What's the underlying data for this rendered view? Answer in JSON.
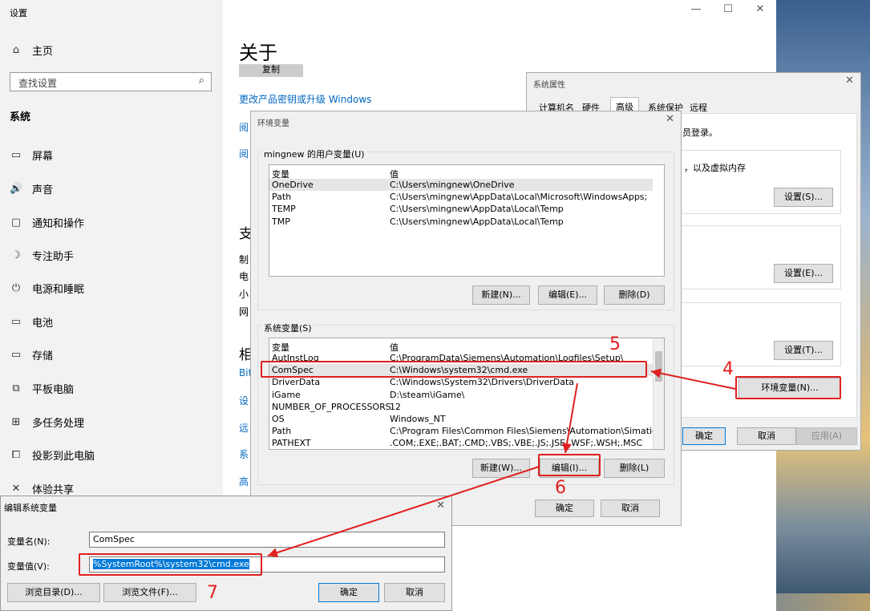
{
  "settings": {
    "window_title": "设置",
    "minimize": "—",
    "maximize": "☐",
    "close": "✕",
    "home": "主页",
    "search_placeholder": "查找设置",
    "section": "系统",
    "nav": [
      {
        "label": "屏幕",
        "icon": "monitor-icon",
        "glyph": "▭"
      },
      {
        "label": "声音",
        "icon": "speaker-icon",
        "glyph": "🔊"
      },
      {
        "label": "通知和操作",
        "icon": "notification-icon",
        "glyph": "▢"
      },
      {
        "label": "专注助手",
        "icon": "moon-icon",
        "glyph": "☽"
      },
      {
        "label": "电源和睡眠",
        "icon": "power-icon",
        "glyph": "⏻"
      },
      {
        "label": "电池",
        "icon": "battery-icon",
        "glyph": "▭"
      },
      {
        "label": "存储",
        "icon": "storage-icon",
        "glyph": "▭"
      },
      {
        "label": "平板电脑",
        "icon": "tablet-icon",
        "glyph": "⧉"
      },
      {
        "label": "多任务处理",
        "icon": "multitask-icon",
        "glyph": "⊞"
      },
      {
        "label": "投影到此电脑",
        "icon": "project-icon",
        "glyph": "⧠"
      },
      {
        "label": "体验共享",
        "icon": "share-icon",
        "glyph": "✕"
      }
    ],
    "page_title": "关于",
    "copy_button": "复制",
    "link_upgrade": "更改产品密钥或升级 Windows",
    "partial": [
      "阅",
      "阅",
      "支",
      "制",
      "电",
      "小",
      "网",
      "相",
      "Bit",
      "设",
      "远",
      "系",
      "高"
    ]
  },
  "sysprops": {
    "title": "系统属性",
    "tabs": [
      "计算机名",
      "硬件",
      "高级",
      "系统保护",
      "远程"
    ],
    "active_tab": "高级",
    "admin_text": "员登录。",
    "perf_text": "，以及虚拟内存",
    "settings_buttons": [
      "设置(S)...",
      "设置(E)...",
      "设置(T)..."
    ],
    "env_button": "环境变量(N)...",
    "ok": "确定",
    "cancel": "取消",
    "apply": "应用(A)"
  },
  "envvars": {
    "title": "环境变量",
    "user_group": "mingnew 的用户变量(U)",
    "col_var": "变量",
    "col_val": "值",
    "user_vars": [
      {
        "name": "OneDrive",
        "value": "C:\\Users\\mingnew\\OneDrive"
      },
      {
        "name": "Path",
        "value": "C:\\Users\\mingnew\\AppData\\Local\\Microsoft\\WindowsApps;"
      },
      {
        "name": "TEMP",
        "value": "C:\\Users\\mingnew\\AppData\\Local\\Temp"
      },
      {
        "name": "TMP",
        "value": "C:\\Users\\mingnew\\AppData\\Local\\Temp"
      }
    ],
    "user_buttons": [
      "新建(N)...",
      "编辑(E)...",
      "删除(D)"
    ],
    "sys_group": "系统变量(S)",
    "sys_vars": [
      {
        "name": "AutInstLog",
        "value": "C:\\ProgramData\\Siemens\\Automation\\Logfiles\\Setup\\"
      },
      {
        "name": "ComSpec",
        "value": "C:\\Windows\\system32\\cmd.exe"
      },
      {
        "name": "DriverData",
        "value": "C:\\Windows\\System32\\Drivers\\DriverData"
      },
      {
        "name": "iGame",
        "value": "D:\\steam\\iGame\\"
      },
      {
        "name": "NUMBER_OF_PROCESSORS",
        "value": "12"
      },
      {
        "name": "OS",
        "value": "Windows_NT"
      },
      {
        "name": "Path",
        "value": "C:\\Program Files\\Common Files\\Siemens\\Automation\\Simatic ..."
      },
      {
        "name": "PATHEXT",
        "value": ".COM;.EXE;.BAT;.CMD;.VBS;.VBE;.JS;.JSE;.WSF;.WSH;.MSC"
      }
    ],
    "sys_buttons": [
      "新建(W)...",
      "编辑(I)...",
      "删除(L)"
    ],
    "ok": "确定",
    "cancel": "取消"
  },
  "editvar": {
    "title": "编辑系统变量",
    "name_label": "变量名(N):",
    "name_value": "ComSpec",
    "value_label": "变量值(V):",
    "value_value": "%SystemRoot%\\system32\\cmd.exe",
    "browse_dir": "浏览目录(D)...",
    "browse_file": "浏览文件(F)...",
    "ok": "确定",
    "cancel": "取消"
  },
  "annotations": {
    "step4": "4",
    "step5": "5",
    "step6": "6",
    "step7": "7",
    "color": "#e02020"
  }
}
